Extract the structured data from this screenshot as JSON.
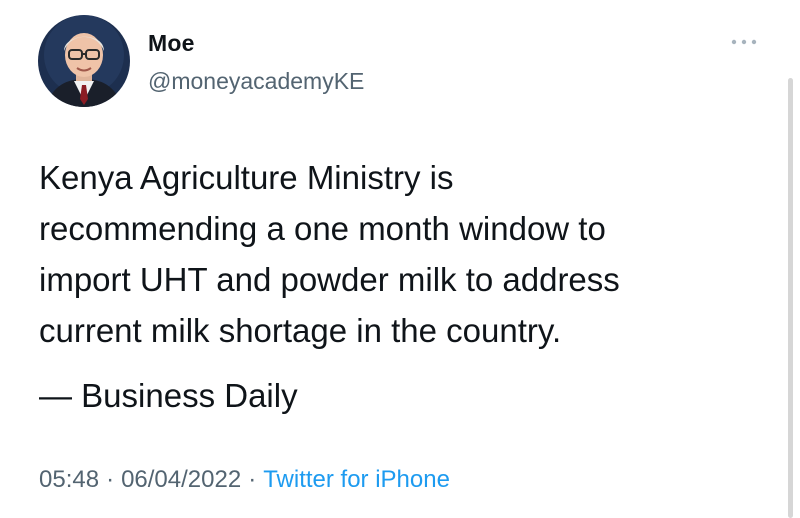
{
  "author": {
    "display_name": "Moe",
    "handle": "@moneyacademyKE",
    "avatar": "portrait-photo"
  },
  "more_icon": "more-dots-icon",
  "tweet": {
    "lines": [
      "Kenya Agriculture Ministry is",
      "recommending a one month window to",
      "import UHT and powder milk to address",
      "current milk shortage in the country."
    ],
    "source": "— Business Daily"
  },
  "meta": {
    "time": "05:48",
    "separator": "·",
    "date": "06/04/2022",
    "client": "Twitter for iPhone"
  },
  "colors": {
    "text_primary": "#0f1419",
    "text_secondary": "#536471",
    "link": "#1d9bf0"
  }
}
